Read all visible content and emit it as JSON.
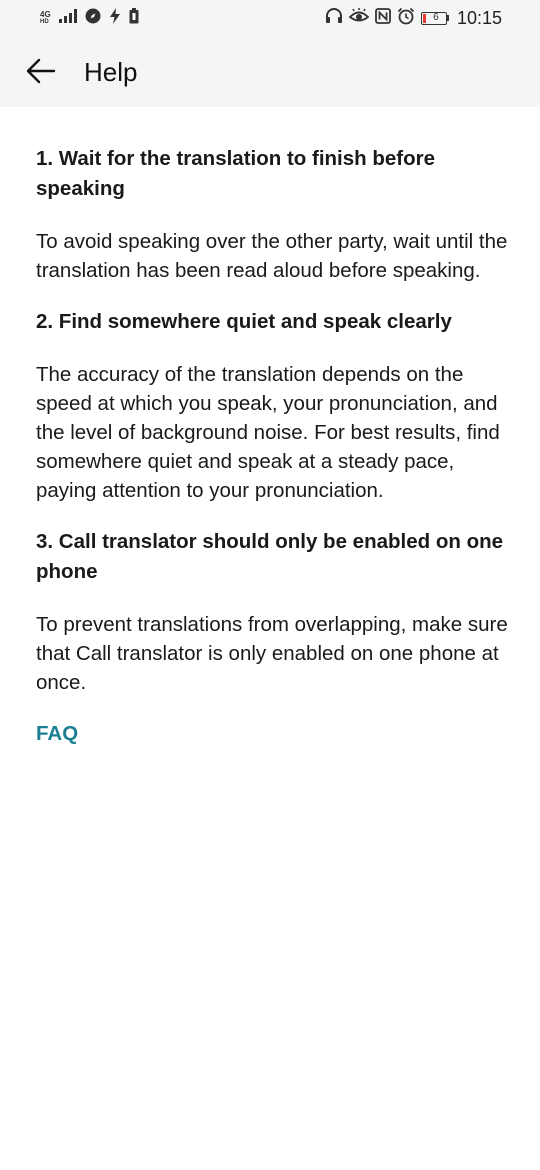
{
  "status_bar": {
    "network_type": "4G",
    "network_sub": "HD",
    "battery_level": "6",
    "time": "10:15",
    "battery_fill_fraction": 0.06
  },
  "header": {
    "title": "Help"
  },
  "sections": [
    {
      "heading": "1. Wait for the translation to finish before speaking",
      "body": "To avoid speaking over the other party, wait until the translation has been read aloud before speaking."
    },
    {
      "heading": "2. Find somewhere quiet and speak clearly",
      "body": "The accuracy of the translation depends on the speed at which you speak, your pronunciation, and the level of background noise. For best results, find somewhere quiet and speak at a steady pace, paying attention to your pronunciation."
    },
    {
      "heading": "3. Call translator should only be enabled on one phone",
      "body": "To prevent translations from overlapping, make sure that Call translator is only enabled on one phone at once."
    }
  ],
  "faq_link": "FAQ",
  "colors": {
    "accent": "#1b7f93",
    "appbar_background": "#f5f5f5",
    "battery_low": "#e53935"
  }
}
